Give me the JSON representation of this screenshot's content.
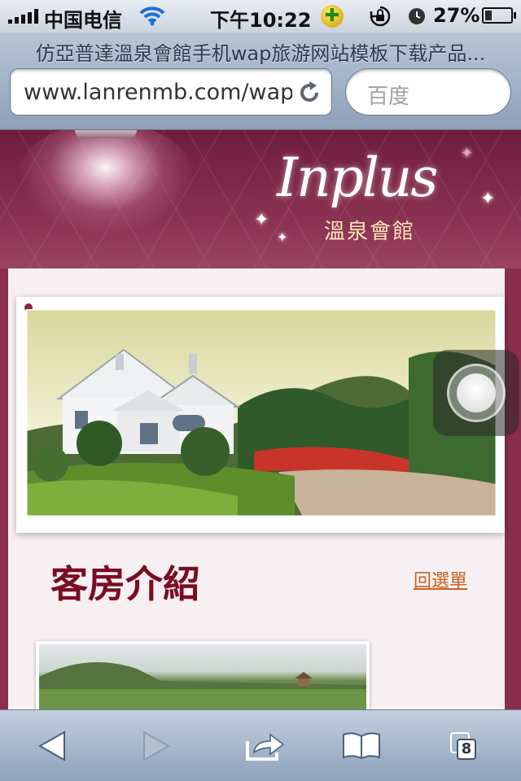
{
  "status_bar": {
    "carrier": "中国电信",
    "time": "下午10:22",
    "battery_percent_label": "27%",
    "battery_level": 0.27,
    "icons": [
      "signal-icon",
      "wifi-icon",
      "qq-icon",
      "rotation-lock-icon",
      "alarm-icon",
      "battery-icon"
    ]
  },
  "browser": {
    "page_title": "仿亞普達溫泉會館手机wap旅游网站模板下载产品...",
    "url": "www.lanrenmb.com/wap",
    "search_placeholder": "百度"
  },
  "page": {
    "logo_script": "Inplus",
    "logo_subtitle": "溫泉會館",
    "section_title": "客房介紹",
    "back_link": "回選單",
    "colors": {
      "banner": "#8d3454",
      "heading": "#7a0d22",
      "link": "#c8621e"
    }
  },
  "toolbar": {
    "tab_count": "8",
    "icons": [
      "back-arrow-icon",
      "forward-arrow-icon",
      "share-icon",
      "bookmarks-icon",
      "tabs-icon"
    ]
  }
}
